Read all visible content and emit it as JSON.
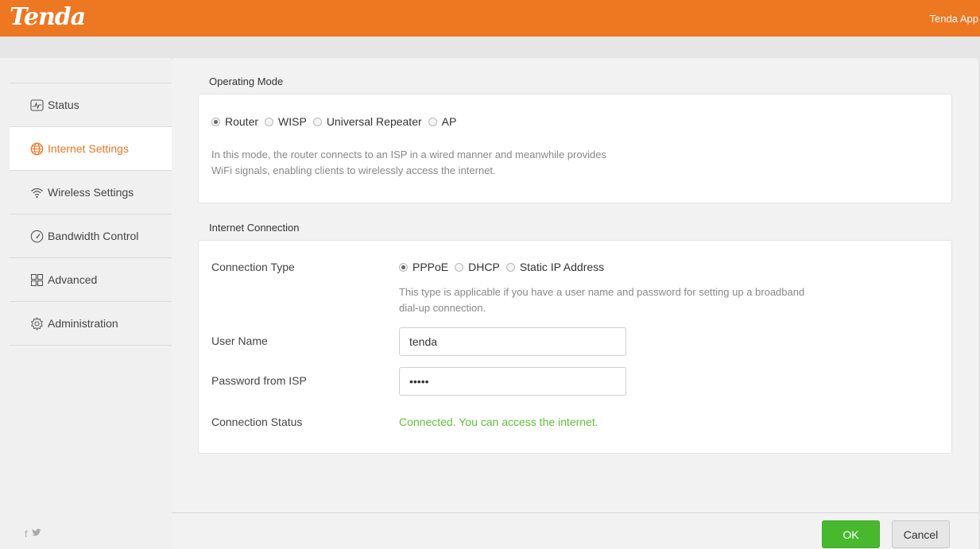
{
  "header": {
    "logo": "Tenda",
    "app_link": "Tenda App",
    "brand_color": "#EE7722"
  },
  "sidebar": {
    "items": [
      {
        "label": "Status",
        "icon": "status-icon",
        "active": false
      },
      {
        "label": "Internet Settings",
        "icon": "globe-icon",
        "active": true
      },
      {
        "label": "Wireless Settings",
        "icon": "wifi-icon",
        "active": false
      },
      {
        "label": "Bandwidth Control",
        "icon": "gauge-icon",
        "active": false
      },
      {
        "label": "Advanced",
        "icon": "grid-icon",
        "active": false
      },
      {
        "label": "Administration",
        "icon": "gear-icon",
        "active": false
      }
    ],
    "social": [
      "facebook-icon",
      "twitter-icon"
    ]
  },
  "operating_mode": {
    "title": "Operating Mode",
    "options": [
      "Router",
      "WISP",
      "Universal Repeater",
      "AP"
    ],
    "selected": "Router",
    "description_line1": "In this mode, the router connects to an ISP in a wired manner and meanwhile provides",
    "description_line2": "WiFi signals, enabling clients to wirelessly access the internet."
  },
  "internet_connection": {
    "title": "Internet Connection",
    "connection_type_label": "Connection Type",
    "types": [
      "PPPoE",
      "DHCP",
      "Static IP Address"
    ],
    "selected_type": "PPPoE",
    "type_description_line1": "This type is applicable if you have a user name and password for setting up a broadband",
    "type_description_line2": "dial-up connection.",
    "username_label": "User Name",
    "username_value": "tenda",
    "password_label": "Password from ISP",
    "password_value": "•••••",
    "status_label": "Connection Status",
    "status_value": "Connected. You can access the internet.",
    "status_color": "#62C13B"
  },
  "footer": {
    "ok_label": "OK",
    "cancel_label": "Cancel",
    "ok_color": "#48B92F"
  }
}
